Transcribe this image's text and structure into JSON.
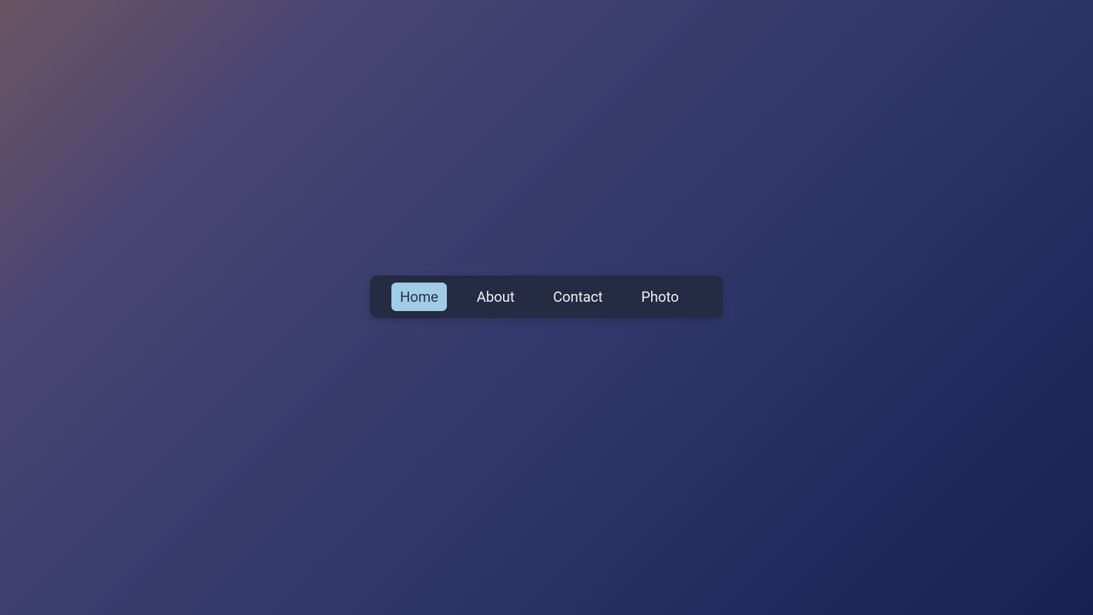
{
  "nav": {
    "items": [
      {
        "label": "Home",
        "active": true
      },
      {
        "label": "About",
        "active": false
      },
      {
        "label": "Contact",
        "active": false
      },
      {
        "label": "Photo",
        "active": false
      }
    ]
  },
  "colors": {
    "nav_background": "#252b42",
    "active_background": "#a0cde5",
    "text_light": "#f0f0f5",
    "text_dark": "#2a3045"
  }
}
